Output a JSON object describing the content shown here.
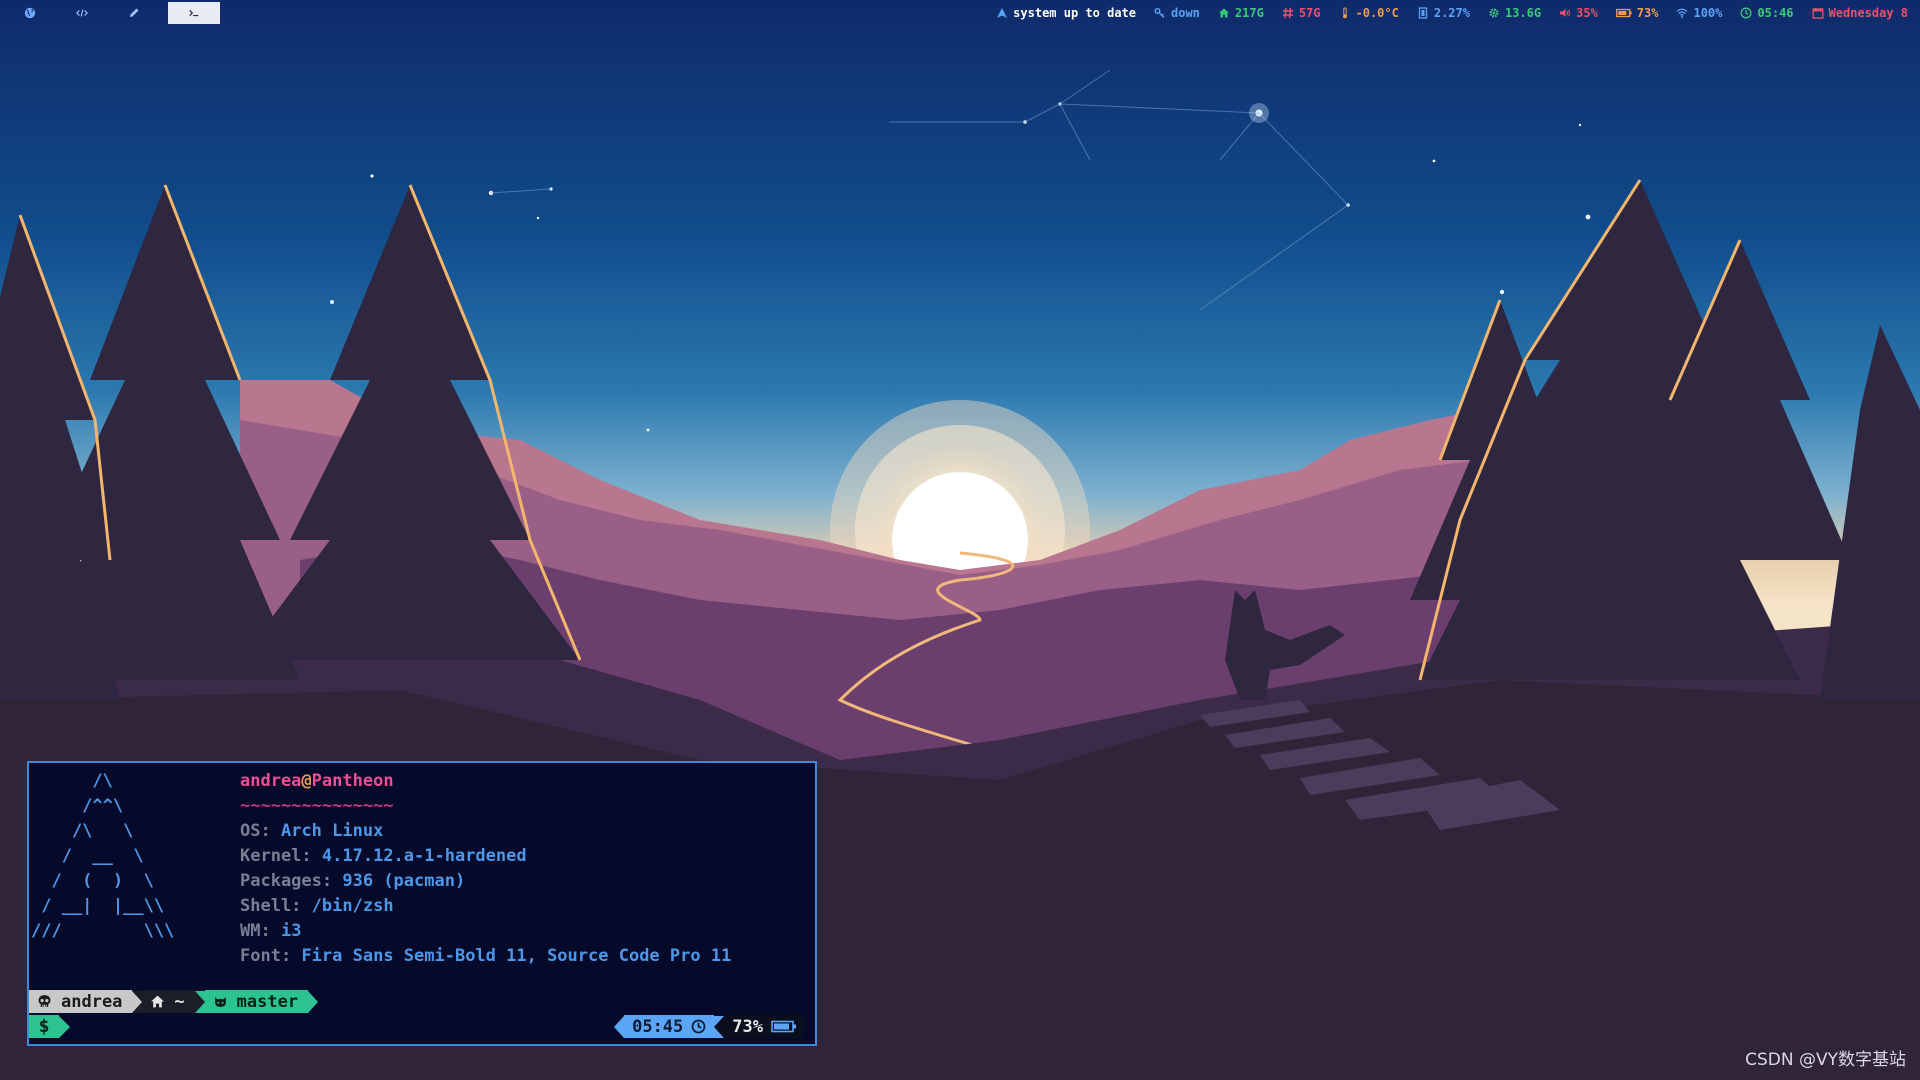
{
  "workspaces": [
    {
      "name": "globe-icon",
      "active": false
    },
    {
      "name": "code-icon",
      "active": false
    },
    {
      "name": "pencil-icon",
      "active": false
    },
    {
      "name": "terminal-icon",
      "active": true
    }
  ],
  "status": {
    "updates": {
      "text": "system up to date",
      "color": "#ffffff",
      "icon": "arch-icon",
      "icon_color": "#5aa5f5"
    },
    "vpn": {
      "text": "down",
      "color": "#5aa5f5",
      "icon": "key-icon"
    },
    "home_disk": {
      "text": "217G",
      "color": "#37c97c",
      "icon": "home-icon"
    },
    "root_disk": {
      "text": "57G",
      "color": "#ee4f6a",
      "icon": "hash-icon"
    },
    "temperature": {
      "text": "-0.0°C",
      "color": "#ec9d4a",
      "icon": "thermometer-icon"
    },
    "cpu": {
      "text": "2.27%",
      "color": "#5aa5f5",
      "icon": "chip-icon"
    },
    "memory": {
      "text": "13.6G",
      "color": "#37c97c",
      "icon": "gear-icon"
    },
    "volume": {
      "text": "35%",
      "color": "#ee4f6a",
      "icon": "speaker-icon"
    },
    "battery": {
      "text": "73%",
      "color": "#ec9d4a",
      "icon": "battery-icon"
    },
    "wifi": {
      "text": "100%",
      "color": "#5aa5f5",
      "icon": "wifi-icon"
    },
    "clock": {
      "text": "05:46",
      "color": "#37c97c",
      "icon": "clock-icon"
    },
    "date": {
      "text": "Wednesday 8",
      "color": "#ee4f6a",
      "icon": "calendar-icon"
    }
  },
  "terminal": {
    "ascii_logo": "      /\\\n     /^^\\\n    /\\   \\\n   /  __  \\\n  /  (  )  \\\n / __|  |__\\\\\n///        \\\\\\",
    "user": "andrea",
    "at": "@",
    "host": "Pantheon",
    "separator": "~~~~~~~~~~~~~~~",
    "info": [
      {
        "key": "OS:",
        "value": "Arch Linux"
      },
      {
        "key": "Kernel:",
        "value": "4.17.12.a-1-hardened"
      },
      {
        "key": "Packages:",
        "value": "936 (pacman)"
      },
      {
        "key": "Shell:",
        "value": "/bin/zsh"
      },
      {
        "key": "WM:",
        "value": "i3"
      },
      {
        "key": "Font:",
        "value": "Fira Sans Semi-Bold 11, Source Code Pro 11"
      }
    ],
    "prompt": {
      "user": "andrea",
      "home": "~",
      "git_branch": "master",
      "symbol": "$",
      "time": "05:45",
      "battery": "73%"
    }
  },
  "watermark": "CSDN @VY数字基站"
}
